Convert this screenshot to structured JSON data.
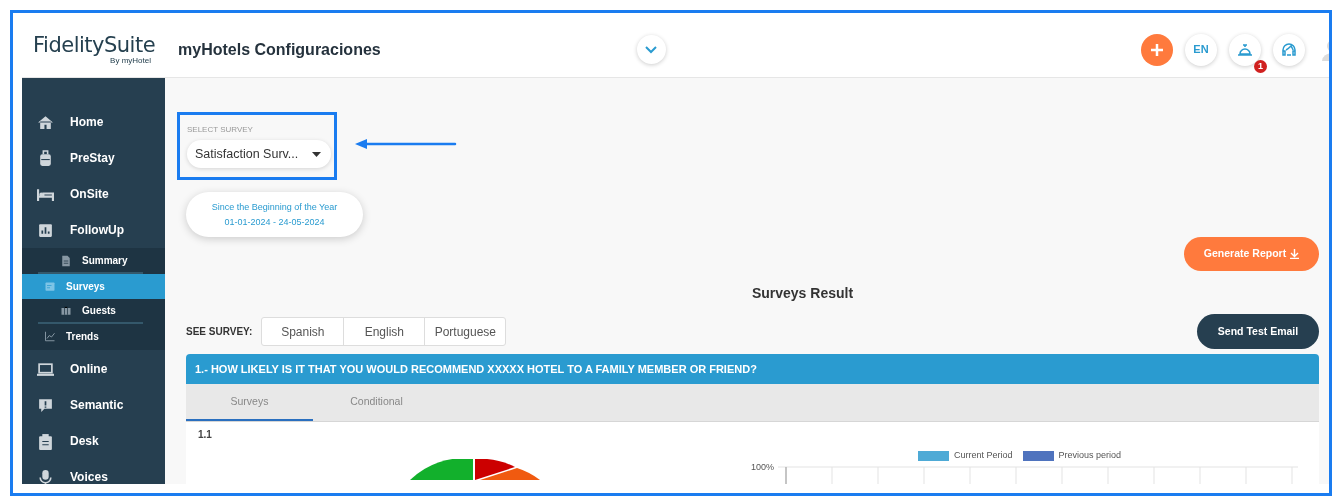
{
  "header": {
    "logo": "FidelitySuite",
    "logo_byline": "By myHotel",
    "title": "myHotels Configuraciones",
    "language": "EN",
    "notification_count": "1"
  },
  "sidebar": {
    "items": [
      {
        "label": "Home",
        "selected": false
      },
      {
        "label": "PreStay",
        "selected": false
      },
      {
        "label": "OnSite",
        "selected": false
      },
      {
        "label": "FollowUp",
        "selected": false,
        "children": [
          {
            "label": "Summary",
            "selected": false
          },
          {
            "label": "Surveys",
            "selected": true
          },
          {
            "label": "Guests",
            "selected": false
          },
          {
            "label": "Trends",
            "selected": false
          }
        ]
      },
      {
        "label": "Online",
        "selected": false
      },
      {
        "label": "Semantic",
        "selected": false
      },
      {
        "label": "Desk",
        "selected": false
      },
      {
        "label": "Voices",
        "selected": false
      }
    ]
  },
  "select_survey": {
    "label": "SELECT SURVEY",
    "value": "Satisfaction Surv..."
  },
  "period": {
    "label": "Since the Beginning of the Year",
    "range": "01-01-2024 - 24-05-2024"
  },
  "generate_report": "Generate Report",
  "section_title": "Surveys Result",
  "see_survey": {
    "label": "SEE SURVEY:",
    "languages": [
      "Spanish",
      "English",
      "Portuguese"
    ]
  },
  "send_test_email": "Send Test Email",
  "question": {
    "title": "1.- HOW LIKELY IS IT THAT YOU WOULD RECOMMEND XXXXX HOTEL TO A FAMILY MEMBER OR FRIEND?",
    "tabs": [
      {
        "label": "Surveys",
        "selected": true
      },
      {
        "label": "Conditional",
        "selected": false
      }
    ],
    "subquestion": "1.1",
    "legend": [
      {
        "label": "Current Period",
        "color": "#4eaad6"
      },
      {
        "label": "Previous period",
        "color": "#4f73be"
      }
    ],
    "y_tick": "100%"
  }
}
